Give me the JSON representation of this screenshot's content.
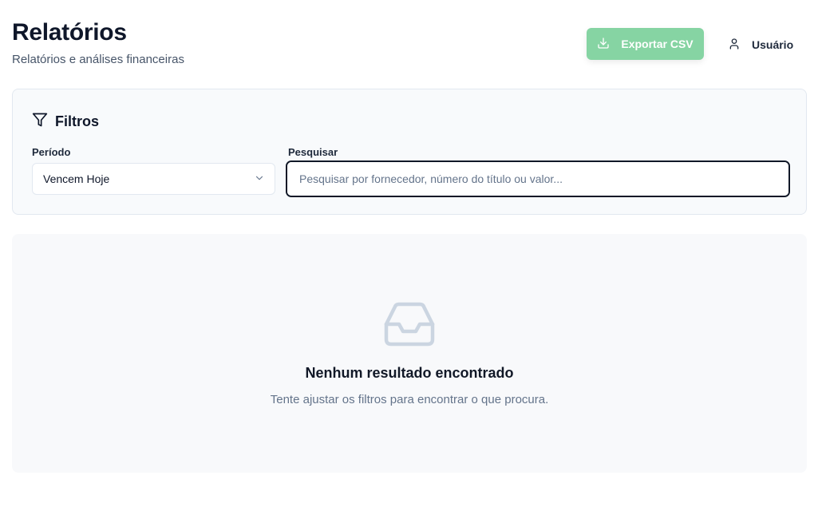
{
  "header": {
    "title": "Relatórios",
    "subtitle": "Relatórios e análises financeiras",
    "export_label": "Exportar CSV",
    "export_icon": "download-icon",
    "user_label": "Usuário",
    "user_icon": "user-icon"
  },
  "filters": {
    "title": "Filtros",
    "icon": "filter-icon",
    "period_label": "Período",
    "period_value": "Vencem Hoje",
    "search_label": "Pesquisar",
    "search_placeholder": "Pesquisar por fornecedor, número do título ou valor...",
    "search_value": ""
  },
  "empty_state": {
    "icon": "inbox-icon",
    "title": "Nenhum resultado encontrado",
    "description": "Tente ajustar os filtros para encontrar o que procura."
  },
  "colors": {
    "export_button": "#86d4a3",
    "text_primary": "#0f172a",
    "text_muted": "#64748b",
    "card_background": "#f8fafc",
    "empty_icon": "#cbd5e1"
  }
}
